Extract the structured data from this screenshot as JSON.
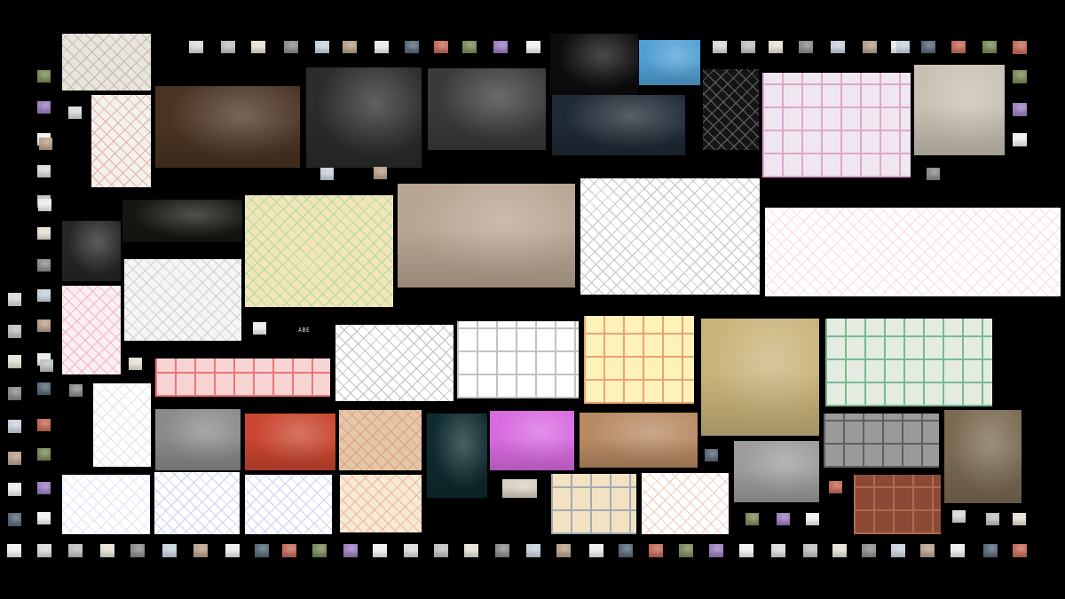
{
  "page": {
    "background": "#000000"
  },
  "wall": {
    "tiles": [
      {
        "name": "ruin-model-photo",
        "bg": "#e9e4dc",
        "c2": "#7a6a57",
        "kind": "sketch"
      },
      {
        "name": "tower-axonometric",
        "bg": "#f4f1ec",
        "c2": "#c0392b",
        "kind": "sketch"
      },
      {
        "name": "pavilion-interior-render",
        "bg": "#4a3322",
        "c2": "#d9a066",
        "kind": "photo"
      },
      {
        "name": "dome-section-render",
        "bg": "#2b2b2b",
        "c2": "#bdbdbd",
        "kind": "photo"
      },
      {
        "name": "column-hall-render",
        "bg": "#3a3a3a",
        "c2": "#c9c9c9",
        "kind": "photo"
      },
      {
        "name": "night-landscape-render",
        "bg": "#0d0d10",
        "c2": "#6d8a6a",
        "kind": "photo"
      },
      {
        "name": "blue-dome-gathering",
        "bg": "#4fa0d4",
        "c2": "#1a2b40",
        "kind": "photo"
      },
      {
        "name": "floating-island-render",
        "bg": "#1e2a35",
        "c2": "#7a9a5a",
        "kind": "photo"
      },
      {
        "name": "wireframe-drawing",
        "bg": "#151515",
        "c2": "#ffffff",
        "kind": "sketch"
      },
      {
        "name": "pink-facade-section",
        "bg": "#f0e6ef",
        "c2": "#d27fb0",
        "kind": "facade"
      },
      {
        "name": "atrium-greenery-render",
        "bg": "#c8c1b3",
        "c2": "#6e6a5f",
        "kind": "photo"
      },
      {
        "name": "green-vault-night",
        "bg": "#141810",
        "c2": "#8a9a6a",
        "kind": "photo"
      },
      {
        "name": "dark-tower-collage",
        "bg": "#262626",
        "c2": "#9a9a9a",
        "kind": "photo"
      },
      {
        "name": "colorful-greenhouse-drawing",
        "bg": "#f2e6b8",
        "c2": "#2fbf71",
        "kind": "sketch"
      },
      {
        "name": "forest-street-render",
        "bg": "#b8a592",
        "c2": "#6b5a48",
        "kind": "photo"
      },
      {
        "name": "theater-axonometric",
        "bg": "#ffffff",
        "c2": "#555555",
        "kind": "sketch"
      },
      {
        "name": "pink-line-elevation",
        "bg": "#ffffff",
        "c2": "#e2a0a0",
        "kind": "sketch"
      },
      {
        "name": "pink-plan-sketch",
        "bg": "#fbeff3",
        "c2": "#e0457b",
        "kind": "sketch"
      },
      {
        "name": "mountain-landscape-drawing",
        "bg": "#f5f5f5",
        "c2": "#888888",
        "kind": "sketch"
      },
      {
        "name": "red-forest-section",
        "bg": "#f7d4d4",
        "c2": "#e8383c",
        "kind": "facade"
      },
      {
        "name": "white-building-axo",
        "bg": "#ffffff",
        "c2": "#444444",
        "kind": "sketch"
      },
      {
        "name": "gridded-section-drawing",
        "bg": "#ffffff",
        "c2": "#9a9a9a",
        "kind": "facade"
      },
      {
        "name": "yellow-house-section",
        "bg": "#fff2b8",
        "c2": "#e06d4c",
        "kind": "facade"
      },
      {
        "name": "bullring-wheatfield",
        "bg": "#c9b47a",
        "c2": "#7d8ca0",
        "kind": "photo"
      },
      {
        "name": "green-housing-block",
        "bg": "#e4ece2",
        "c2": "#2e9a5e",
        "kind": "facade"
      },
      {
        "name": "circular-plan-sketch",
        "bg": "#ffffff",
        "c2": "#b0b0b0",
        "kind": "sketch"
      },
      {
        "name": "ruined-shelter-bw",
        "bg": "#8a8a8a",
        "c2": "#3d3d3d",
        "kind": "photo"
      },
      {
        "name": "red-tunnel-render",
        "bg": "#c9452f",
        "c2": "#f0d6c4",
        "kind": "photo"
      },
      {
        "name": "collage-map-drawing",
        "bg": "#e3c7a8",
        "c2": "#d4562b",
        "kind": "sketch"
      },
      {
        "name": "neon-towers-render",
        "bg": "#0e2a2f",
        "c2": "#4de0c8",
        "kind": "photo"
      },
      {
        "name": "violet-installation",
        "bg": "#d86ae0",
        "c2": "#ffffff",
        "kind": "photo"
      },
      {
        "name": "sunset-meadow-photo",
        "bg": "#b88a63",
        "c2": "#4e5a38",
        "kind": "photo"
      },
      {
        "name": "glass-pavilion-render",
        "bg": "#9a9a9a",
        "c2": "#3a3a3a",
        "kind": "facade"
      },
      {
        "name": "tapestry-collage",
        "bg": "#7a6a52",
        "c2": "#d9b23a",
        "kind": "photo"
      },
      {
        "name": "street-procession-bw",
        "bg": "#9c9c9c",
        "c2": "#4a4a4a",
        "kind": "photo"
      },
      {
        "name": "blue-pencil-plan",
        "bg": "#ffffff",
        "c2": "#9fb6e0",
        "kind": "sketch"
      },
      {
        "name": "blue-line-street",
        "bg": "#ffffff",
        "c2": "#6a7fd0",
        "kind": "sketch"
      },
      {
        "name": "blue-line-interior",
        "bg": "#ffffff",
        "c2": "#6a7fd0",
        "kind": "sketch"
      },
      {
        "name": "ornate-frame-drawing",
        "bg": "#f6e9d6",
        "c2": "#e25a2a",
        "kind": "sketch"
      },
      {
        "name": "small-photo-strip",
        "bg": "#d8d0c0",
        "c2": "#555555",
        "kind": "photo"
      },
      {
        "name": "sunset-comic-panels",
        "bg": "#f3e2c2",
        "c2": "#6d88a8",
        "kind": "facade"
      },
      {
        "name": "orange-line-plan",
        "bg": "#ffffff",
        "c2": "#c76f4f",
        "kind": "sketch"
      },
      {
        "name": "brick-wall-collage",
        "bg": "#8c4a36",
        "c2": "#c98260",
        "kind": "facade"
      }
    ],
    "caption_label": "ABE"
  }
}
